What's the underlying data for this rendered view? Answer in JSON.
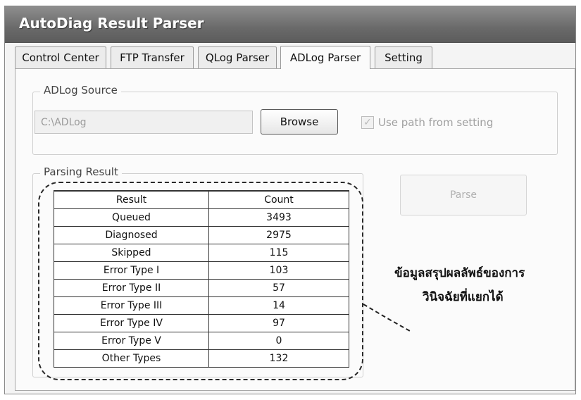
{
  "window": {
    "title": "AutoDiag Result Parser"
  },
  "tabs": [
    {
      "label": "Control Center"
    },
    {
      "label": "FTP Transfer"
    },
    {
      "label": "QLog Parser"
    },
    {
      "label": "ADLog Parser",
      "active": true
    },
    {
      "label": "Setting"
    }
  ],
  "source_group": {
    "legend": "ADLog Source",
    "path_value": "C:\\ADLog",
    "browse_label": "Browse",
    "use_path_label": "Use path from setting",
    "use_path_checked": true
  },
  "result_group": {
    "legend": "Parsing Result",
    "parse_label": "Parse",
    "table": {
      "headers": [
        "Result",
        "Count"
      ],
      "rows": [
        [
          "Queued",
          "3493"
        ],
        [
          "Diagnosed",
          "2975"
        ],
        [
          "Skipped",
          "115"
        ],
        [
          "Error Type I",
          "103"
        ],
        [
          "Error Type II",
          "57"
        ],
        [
          "Error Type III",
          "14"
        ],
        [
          "Error Type IV",
          "97"
        ],
        [
          "Error Type V",
          "0"
        ],
        [
          "Other Types",
          "132"
        ]
      ]
    }
  },
  "annotation": {
    "line1": "ข้อมูลสรุปผลลัพธ์ของการ",
    "line2": "วินิจฉัยที่แยกได้"
  },
  "icons": {
    "checkbox": "check-icon"
  }
}
